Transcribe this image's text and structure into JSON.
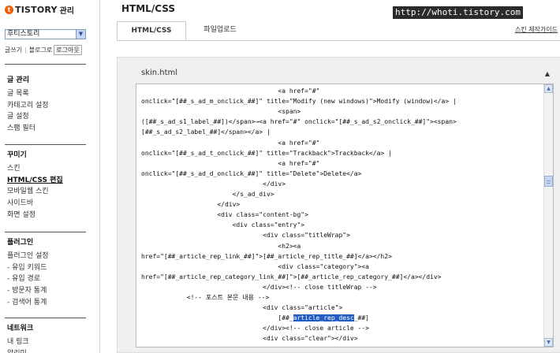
{
  "sidebar": {
    "logo": {
      "brand": "TISTORY",
      "sub": "관리"
    },
    "blog_select": {
      "value": "후티스토리"
    },
    "quick_links": {
      "write": "글쓰기",
      "blog": "블로그로",
      "logout": "로그아웃"
    },
    "sections": [
      {
        "title": "글 관리",
        "items": [
          "글 목록",
          "카테고리 설정",
          "글 설정",
          "스팸 필터"
        ]
      },
      {
        "title": "꾸미기",
        "items": [
          "스킨",
          "HTML/CSS 편집",
          "모바일웹 스킨",
          "사이드바",
          "화면 설정"
        ],
        "active": 1
      },
      {
        "title": "플러그인",
        "items": [
          "플러그인 설정",
          "- 유입 키워드",
          "- 유입 경로",
          "- 방문자 통계",
          "- 검색어 통계"
        ]
      },
      {
        "title": "네트워크",
        "items": [
          "내 링크",
          "알리미"
        ]
      }
    ]
  },
  "main": {
    "title": "HTML/CSS",
    "tabs": [
      {
        "label": "HTML/CSS",
        "active": true
      },
      {
        "label": "파일업로드",
        "active": false
      }
    ],
    "skin_guide": "스킨 제작가이드",
    "editor": {
      "file_name": "skin.html",
      "code_lines": [
        "                                    <a href=\"#\"",
        "onclick=\"[##_s_ad_m_onclick_##]\" title=\"Modify (new windows)\">Modify (window)</a> |",
        "                                    <span>",
        "([##_s_ad_s1_label_##])</span>→<a href=\"#\" onclick=\"[##_s_ad_s2_onclick_##]\"><span>",
        "[##_s_ad_s2_label_##]</span></a> |",
        "                                    <a href=\"#\"",
        "onclick=\"[##_s_ad_t_onclick_##]\" title=\"Trackback\">Trackback</a> |",
        "                                    <a href=\"#\"",
        "onclick=\"[##_s_ad_d_onclick_##]\" title=\"Delete\">Delete</a>",
        "                                </div>",
        "                        </s_ad_div>",
        "                    </div>",
        "                    <div class=\"content-bg\">",
        "                        <div class=\"entry\">",
        "                                <div class=\"titleWrap\">",
        "                                    <h2><a",
        "href=\"[##_article_rep_link_##]\">[##_article_rep_title_##]</a></h2>",
        "                                    <div class=\"category\"><a",
        "href=\"[##_article_rep_category_link_##]\">[##_article_rep_category_##]</a></div>",
        "                                </div><!-- close titleWrap -->",
        "            <!-- 포스트 본문 내용 -->",
        "                                <div class=\"article\">",
        "                                    [##_article_rep_desc_##]",
        "                                </div><!-- close article -->",
        "                                <div class=\"clear\"></div>"
      ],
      "highlight": {
        "line": 22,
        "text": "article_rep_desc"
      }
    }
  },
  "overlay": {
    "url": "http://whoti.tistory.com"
  },
  "colors": {
    "accent": "#f25c05",
    "selection": "#1f5bc1"
  }
}
